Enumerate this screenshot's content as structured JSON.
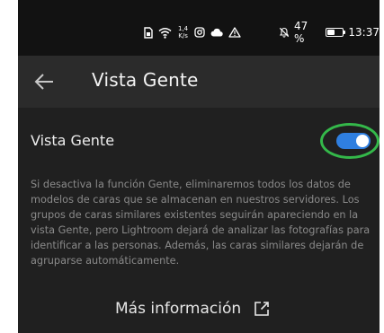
{
  "status_bar": {
    "icons": [
      "sim-icon",
      "wifi-icon",
      "network-speed",
      "instagram-icon",
      "cloud-icon",
      "warning-icon"
    ],
    "speed_value": "1,4",
    "speed_unit": "K/s",
    "battery_percent_text": "47 %",
    "battery_level": 0.47,
    "time": "13:37",
    "mute_icon": "bell-off-icon"
  },
  "app_bar": {
    "back_icon": "arrow-left-icon",
    "title": "Vista Gente"
  },
  "setting": {
    "label": "Vista Gente",
    "toggle_on": true,
    "accent_color": "#2f7fe0",
    "highlight_color": "#34b84a"
  },
  "description": "Si desactiva la función Gente, eliminaremos todos los datos de modelos de caras que se almacenan en nuestros servidores. Los grupos de caras similares existentes seguirán apareciendo en la vista Gente, pero Lightroom dejará de analizar las fotografías para identificar a las personas. Además, las caras similares dejarán de agruparse automáticamente.",
  "more_info": {
    "label": "Más información",
    "icon": "external-link-icon"
  }
}
